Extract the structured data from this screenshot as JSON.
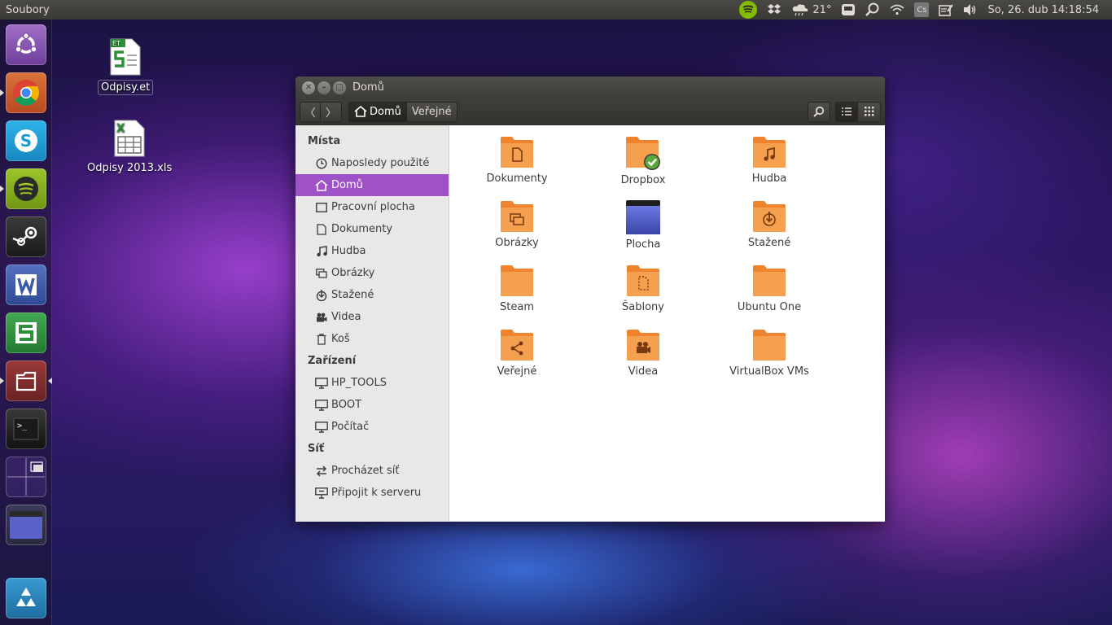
{
  "top_panel": {
    "app_title": "Soubory",
    "weather_temp": "21°",
    "keyboard_layout": "Cs",
    "clock": "So, 26. dub 14:18:54"
  },
  "launcher": {
    "items": [
      {
        "name": "dash-home",
        "color": "#8a52b5"
      },
      {
        "name": "chrome",
        "color": "#c25a2a"
      },
      {
        "name": "skype",
        "color": "#1b9bd6"
      },
      {
        "name": "spotify",
        "color": "#7aa114"
      },
      {
        "name": "steam",
        "color": "#2a2a2a"
      },
      {
        "name": "wps-writer",
        "color": "#3c58a8"
      },
      {
        "name": "wps-spreadsheets",
        "color": "#2e8f3a"
      },
      {
        "name": "files",
        "color": "#7a2d2d"
      },
      {
        "name": "terminal",
        "color": "#2a2a2a"
      },
      {
        "name": "workspace-switcher",
        "color": "#3b2a6a"
      },
      {
        "name": "show-desktop",
        "color": "#4a4fa8"
      },
      {
        "name": "trash",
        "color": "#2a7fb8"
      }
    ]
  },
  "desktop": {
    "icons": [
      {
        "label": "Odpisy.et"
      },
      {
        "label": "Odpisy 2013.xls"
      }
    ]
  },
  "window": {
    "title": "Domů",
    "breadcrumb": {
      "home": "Domů",
      "next": "Veřejné"
    },
    "sidebar": {
      "places_heading": "Místa",
      "places": [
        {
          "label": "Naposledy použité",
          "icon": "clock-icon"
        },
        {
          "label": "Domů",
          "icon": "home-icon",
          "active": true
        },
        {
          "label": "Pracovní plocha",
          "icon": "desktop-icon"
        },
        {
          "label": "Dokumenty",
          "icon": "document-icon"
        },
        {
          "label": "Hudba",
          "icon": "music-icon"
        },
        {
          "label": "Obrázky",
          "icon": "pictures-icon"
        },
        {
          "label": "Stažené",
          "icon": "download-icon"
        },
        {
          "label": "Videa",
          "icon": "video-icon"
        },
        {
          "label": "Koš",
          "icon": "trash-icon"
        }
      ],
      "devices_heading": "Zařízení",
      "devices": [
        {
          "label": "HP_TOOLS",
          "icon": "drive-icon"
        },
        {
          "label": "BOOT",
          "icon": "drive-icon"
        },
        {
          "label": "Počítač",
          "icon": "computer-icon"
        }
      ],
      "network_heading": "Síť",
      "network": [
        {
          "label": "Procházet síť",
          "icon": "network-icon"
        },
        {
          "label": "Připojit k serveru",
          "icon": "server-icon"
        }
      ]
    },
    "files": [
      {
        "label": "Dokumenty",
        "emblem": "document"
      },
      {
        "label": "Dropbox",
        "emblem": "dropbox-check"
      },
      {
        "label": "Hudba",
        "emblem": "music"
      },
      {
        "label": "Obrázky",
        "emblem": "pictures"
      },
      {
        "label": "Plocha",
        "emblem": "desktop"
      },
      {
        "label": "Stažené",
        "emblem": "download"
      },
      {
        "label": "Steam",
        "emblem": "none"
      },
      {
        "label": "Šablony",
        "emblem": "template"
      },
      {
        "label": "Ubuntu One",
        "emblem": "none"
      },
      {
        "label": "Veřejné",
        "emblem": "share"
      },
      {
        "label": "Videa",
        "emblem": "video"
      },
      {
        "label": "VirtualBox VMs",
        "emblem": "none"
      }
    ]
  },
  "colors": {
    "accent": "#9f52c7",
    "folder": "#f0842e",
    "panel": "#3c3b37"
  }
}
